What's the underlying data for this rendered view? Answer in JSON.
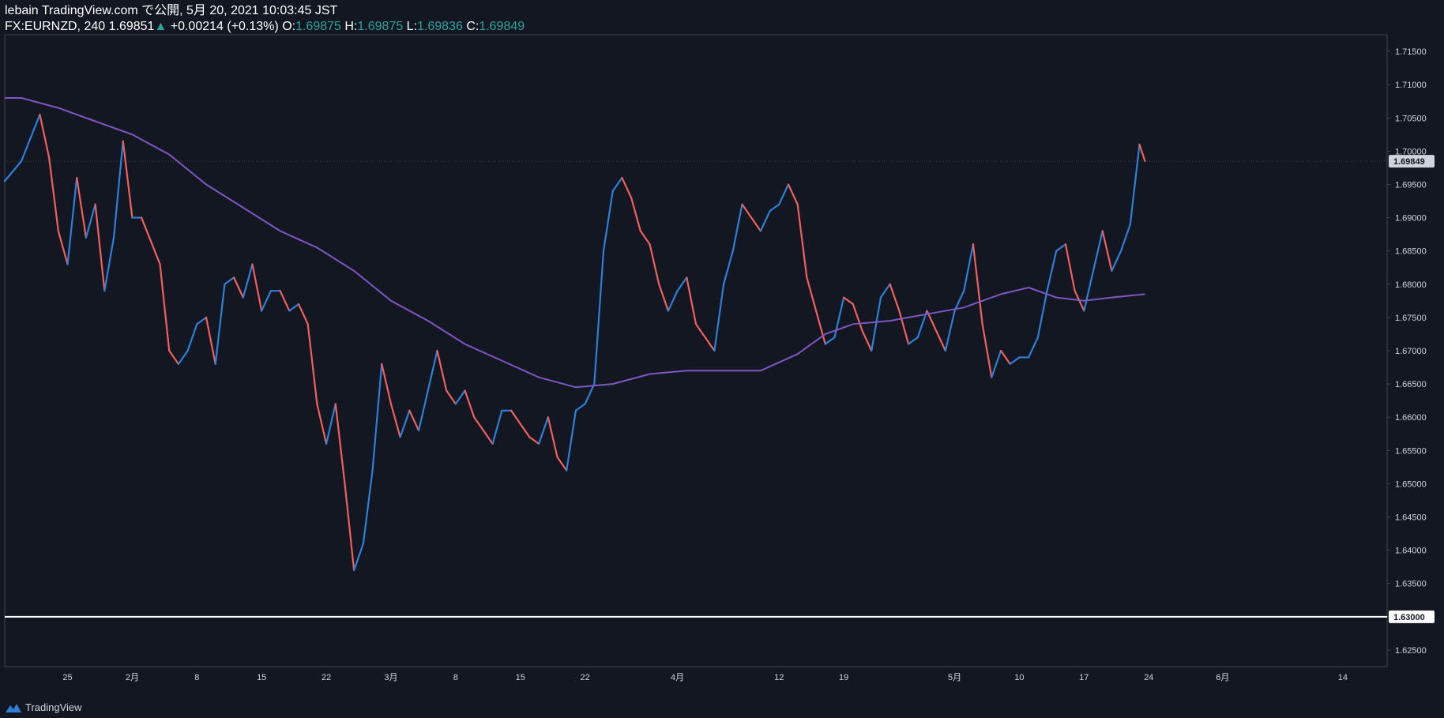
{
  "header": {
    "publisher_line": "lebain TradingView.com で公開, 5月 20, 2021 10:03:45 JST",
    "symbol": "FX:EURNZD, 240",
    "last": "1.69851",
    "change": "+0.00214 (+0.13%)",
    "o_label": "O:",
    "o_value": "1.69875",
    "h_label": "H:",
    "h_value": "1.69875",
    "l_label": "L:",
    "l_value": "1.69836",
    "c_label": "C:",
    "c_value": "1.69849"
  },
  "footer": {
    "brand": "TradingView"
  },
  "colors": {
    "background": "#131722",
    "up": "#2e7fd8",
    "down": "#f0605d",
    "ma": "#7e57c2",
    "hline": "#ffffff",
    "axis_text": "#d1d4dc",
    "price_tag_bg": "#d1d4dc"
  },
  "chart_data": {
    "type": "line",
    "symbol": "EURNZD",
    "timeframe": "240",
    "ylim": [
      1.6225,
      1.7175
    ],
    "y_ticks": [
      "1.71500",
      "1.71000",
      "1.70500",
      "1.70000",
      "1.69500",
      "1.69000",
      "1.68500",
      "1.68000",
      "1.67500",
      "1.67000",
      "1.66500",
      "1.66000",
      "1.65500",
      "1.65000",
      "1.64500",
      "1.64000",
      "1.63500",
      "1.63000",
      "1.62500"
    ],
    "x_ticks": [
      {
        "label": "25",
        "day": 5
      },
      {
        "label": "2月",
        "day": 12
      },
      {
        "label": "8",
        "day": 19
      },
      {
        "label": "15",
        "day": 26
      },
      {
        "label": "22",
        "day": 33
      },
      {
        "label": "3月",
        "day": 40
      },
      {
        "label": "8",
        "day": 47
      },
      {
        "label": "15",
        "day": 54
      },
      {
        "label": "22",
        "day": 61
      },
      {
        "label": "4月",
        "day": 71
      },
      {
        "label": "12",
        "day": 82
      },
      {
        "label": "19",
        "day": 89
      },
      {
        "label": "5月",
        "day": 101
      },
      {
        "label": "10",
        "day": 108
      },
      {
        "label": "17",
        "day": 115
      },
      {
        "label": "24",
        "day": 122
      },
      {
        "label": "6月",
        "day": 130
      },
      {
        "label": "14",
        "day": 143
      }
    ],
    "x_range_days": [
      -1.8,
      147.8
    ],
    "current_price": "1.69849",
    "current_value": 1.69849,
    "horizontal_line": {
      "value": 1.63,
      "label": "1.63000"
    },
    "price_path": [
      [
        -1.8,
        1.6955
      ],
      [
        0,
        1.6985
      ],
      [
        2,
        1.7055
      ],
      [
        3,
        1.699
      ],
      [
        4,
        1.688
      ],
      [
        5,
        1.683
      ],
      [
        6,
        1.696
      ],
      [
        7,
        1.687
      ],
      [
        8,
        1.692
      ],
      [
        9,
        1.679
      ],
      [
        10,
        1.687
      ],
      [
        11,
        1.7015
      ],
      [
        12,
        1.69
      ],
      [
        13,
        1.69
      ],
      [
        14,
        1.6865
      ],
      [
        15,
        1.683
      ],
      [
        16,
        1.67
      ],
      [
        17,
        1.668
      ],
      [
        18,
        1.67
      ],
      [
        19,
        1.674
      ],
      [
        20,
        1.675
      ],
      [
        21,
        1.668
      ],
      [
        22,
        1.68
      ],
      [
        23,
        1.681
      ],
      [
        24,
        1.678
      ],
      [
        25,
        1.683
      ],
      [
        26,
        1.676
      ],
      [
        27,
        1.679
      ],
      [
        28,
        1.679
      ],
      [
        29,
        1.676
      ],
      [
        30,
        1.677
      ],
      [
        31,
        1.674
      ],
      [
        32,
        1.662
      ],
      [
        33,
        1.656
      ],
      [
        34,
        1.662
      ],
      [
        35,
        1.65
      ],
      [
        36,
        1.637
      ],
      [
        37,
        1.641
      ],
      [
        38,
        1.652
      ],
      [
        39,
        1.668
      ],
      [
        40,
        1.662
      ],
      [
        41,
        1.657
      ],
      [
        42,
        1.661
      ],
      [
        43,
        1.658
      ],
      [
        44,
        1.664
      ],
      [
        45,
        1.67
      ],
      [
        46,
        1.664
      ],
      [
        47,
        1.662
      ],
      [
        48,
        1.664
      ],
      [
        49,
        1.66
      ],
      [
        50,
        1.658
      ],
      [
        51,
        1.656
      ],
      [
        52,
        1.661
      ],
      [
        53,
        1.661
      ],
      [
        54,
        1.659
      ],
      [
        55,
        1.657
      ],
      [
        56,
        1.656
      ],
      [
        57,
        1.66
      ],
      [
        58,
        1.654
      ],
      [
        59,
        1.652
      ],
      [
        60,
        1.661
      ],
      [
        61,
        1.662
      ],
      [
        62,
        1.665
      ],
      [
        63,
        1.685
      ],
      [
        64,
        1.694
      ],
      [
        65,
        1.696
      ],
      [
        66,
        1.693
      ],
      [
        67,
        1.688
      ],
      [
        68,
        1.686
      ],
      [
        69,
        1.68
      ],
      [
        70,
        1.676
      ],
      [
        71,
        1.679
      ],
      [
        72,
        1.681
      ],
      [
        73,
        1.674
      ],
      [
        74,
        1.672
      ],
      [
        75,
        1.67
      ],
      [
        76,
        1.68
      ],
      [
        77,
        1.685
      ],
      [
        78,
        1.692
      ],
      [
        79,
        1.69
      ],
      [
        80,
        1.688
      ],
      [
        81,
        1.691
      ],
      [
        82,
        1.692
      ],
      [
        83,
        1.695
      ],
      [
        84,
        1.692
      ],
      [
        85,
        1.681
      ],
      [
        86,
        1.676
      ],
      [
        87,
        1.671
      ],
      [
        88,
        1.672
      ],
      [
        89,
        1.678
      ],
      [
        90,
        1.677
      ],
      [
        91,
        1.673
      ],
      [
        92,
        1.67
      ],
      [
        93,
        1.678
      ],
      [
        94,
        1.68
      ],
      [
        95,
        1.676
      ],
      [
        96,
        1.671
      ],
      [
        97,
        1.672
      ],
      [
        98,
        1.676
      ],
      [
        99,
        1.673
      ],
      [
        100,
        1.67
      ],
      [
        101,
        1.676
      ],
      [
        102,
        1.679
      ],
      [
        103,
        1.686
      ],
      [
        104,
        1.674
      ],
      [
        105,
        1.666
      ],
      [
        106,
        1.67
      ],
      [
        107,
        1.668
      ],
      [
        108,
        1.669
      ],
      [
        109,
        1.669
      ],
      [
        110,
        1.672
      ],
      [
        111,
        1.679
      ],
      [
        112,
        1.685
      ],
      [
        113,
        1.686
      ],
      [
        114,
        1.679
      ],
      [
        115,
        1.676
      ],
      [
        116,
        1.682
      ],
      [
        117,
        1.688
      ],
      [
        118,
        1.682
      ],
      [
        119,
        1.685
      ],
      [
        120,
        1.689
      ],
      [
        121,
        1.701
      ],
      [
        121.6,
        1.6985
      ]
    ],
    "ma_path": [
      [
        -1.8,
        1.708
      ],
      [
        0,
        1.708
      ],
      [
        4,
        1.7065
      ],
      [
        8,
        1.7045
      ],
      [
        12,
        1.7025
      ],
      [
        16,
        1.6995
      ],
      [
        20,
        1.695
      ],
      [
        24,
        1.6915
      ],
      [
        28,
        1.688
      ],
      [
        32,
        1.6855
      ],
      [
        36,
        1.682
      ],
      [
        40,
        1.6775
      ],
      [
        44,
        1.6745
      ],
      [
        48,
        1.671
      ],
      [
        52,
        1.6685
      ],
      [
        56,
        1.666
      ],
      [
        60,
        1.6645
      ],
      [
        64,
        1.665
      ],
      [
        68,
        1.6665
      ],
      [
        72,
        1.667
      ],
      [
        76,
        1.667
      ],
      [
        80,
        1.667
      ],
      [
        84,
        1.6695
      ],
      [
        87,
        1.6725
      ],
      [
        90,
        1.674
      ],
      [
        94,
        1.6745
      ],
      [
        98,
        1.6755
      ],
      [
        102,
        1.6765
      ],
      [
        106,
        1.6785
      ],
      [
        109,
        1.6795
      ],
      [
        112,
        1.678
      ],
      [
        115,
        1.6775
      ],
      [
        118,
        1.678
      ],
      [
        121.6,
        1.6785
      ]
    ]
  }
}
